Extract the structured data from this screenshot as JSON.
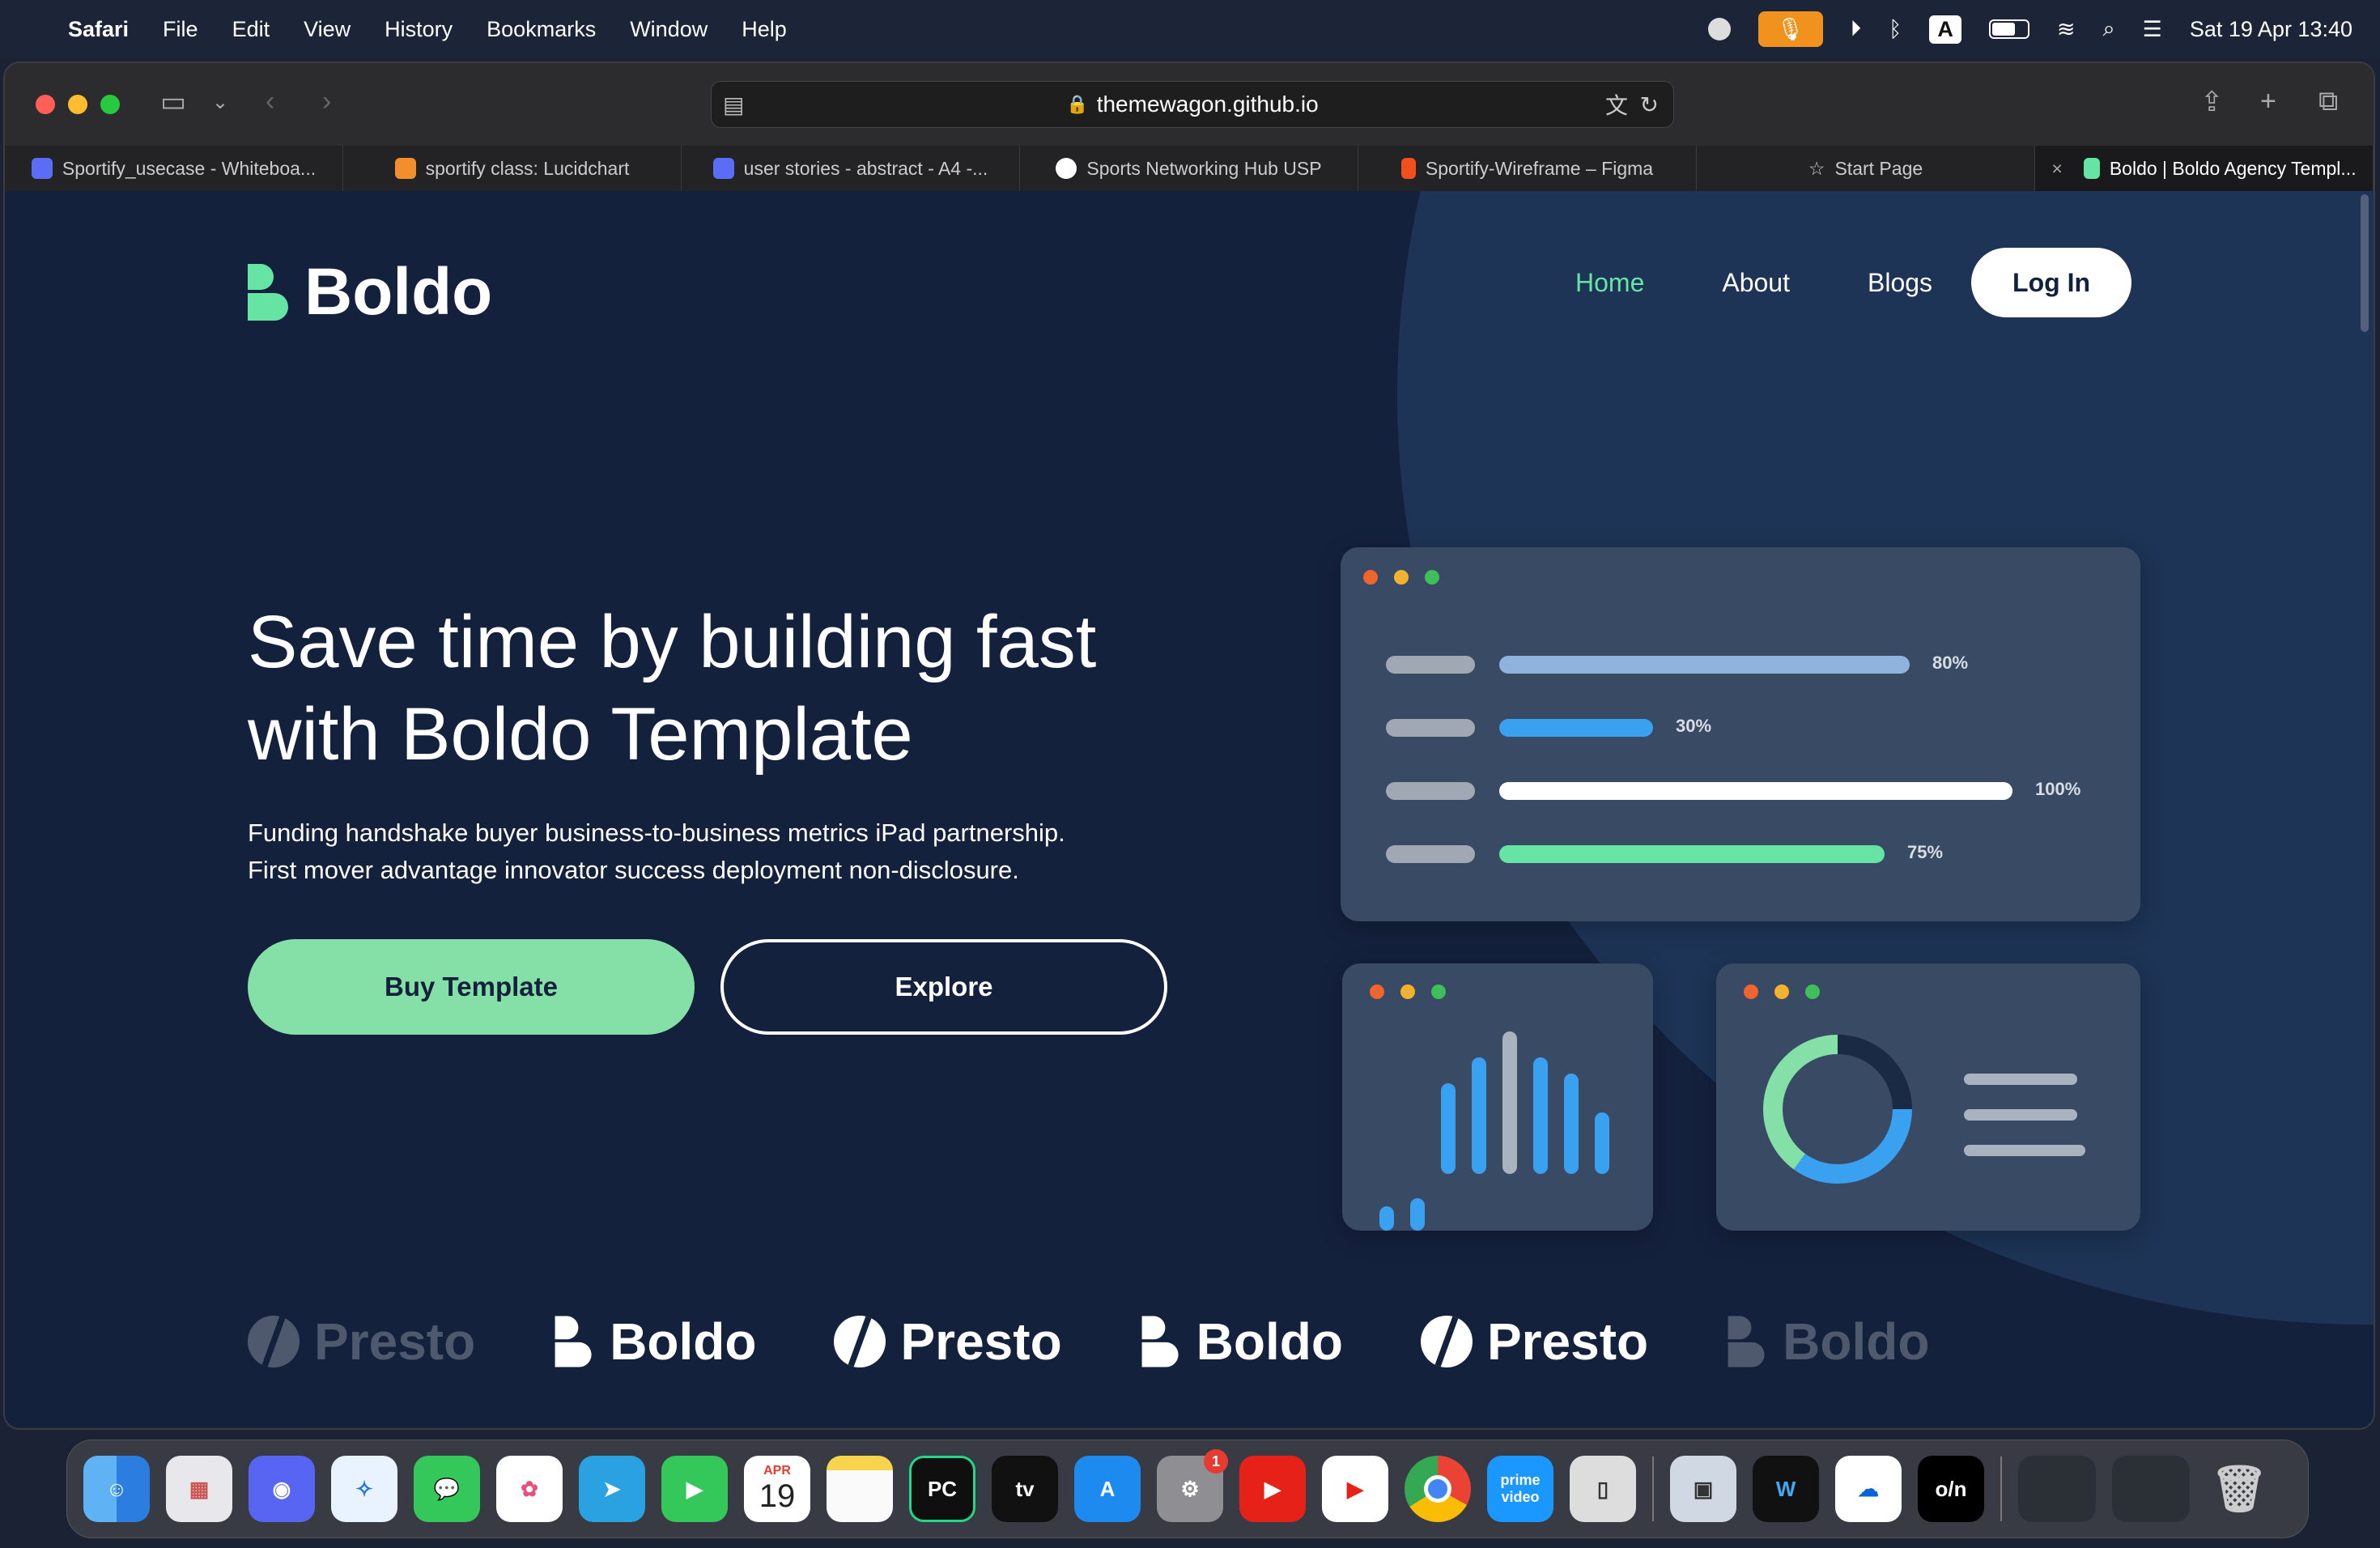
{
  "menubar": {
    "app": "Safari",
    "items": [
      "File",
      "Edit",
      "View",
      "History",
      "Bookmarks",
      "Window",
      "Help"
    ],
    "datetime": "Sat 19 Apr  13:40",
    "keyboard": "A"
  },
  "browser": {
    "url": "themewagon.github.io",
    "tabs": [
      {
        "label": "Sportify_usecase - Whiteboa...",
        "icon": "whiteboard-icon"
      },
      {
        "label": "sportify class: Lucidchart",
        "icon": "lucidchart-icon"
      },
      {
        "label": "user stories - abstract - A4 -...",
        "icon": "whiteboard-icon"
      },
      {
        "label": "Sports Networking Hub USP",
        "icon": "chatgpt-icon"
      },
      {
        "label": "Sportify-Wireframe – Figma",
        "icon": "figma-icon"
      },
      {
        "label": "Start Page",
        "icon": "star-icon"
      },
      {
        "label": "Boldo | Boldo Agency Templ...",
        "icon": "boldo-icon"
      }
    ]
  },
  "site": {
    "logo": "Boldo",
    "nav": {
      "home": "Home",
      "about": "About",
      "blogs": "Blogs",
      "login": "Log In"
    },
    "hero": {
      "line1": "Save time by building fast",
      "line2": "with Boldo Template",
      "sub1": "Funding handshake buyer business-to-business metrics iPad partnership.",
      "sub2": "First mover advantage innovator success deployment non-disclosure.",
      "buy": "Buy Template",
      "explore": "Explore"
    },
    "progress": [
      {
        "label": "80%",
        "value": 0.8,
        "color": "#8fb3dd"
      },
      {
        "label": "30%",
        "value": 0.3,
        "color": "#3aa0f0"
      },
      {
        "label": "100%",
        "value": 1.0,
        "color": "#ffffff"
      },
      {
        "label": "75%",
        "value": 0.75,
        "color": "#65e4a3"
      }
    ],
    "bars": [
      0.15,
      0.2,
      0.56,
      0.72,
      0.88,
      0.72,
      0.62,
      0.38
    ],
    "donut": {
      "green": 0.4,
      "blue": 0.35,
      "dark": 0.25
    },
    "brands": [
      "Presto",
      "Boldo",
      "Presto",
      "Boldo",
      "Presto",
      "Boldo"
    ]
  },
  "dock": {
    "apps": [
      "finder-icon",
      "launchpad-icon",
      "discord-icon",
      "safari-icon",
      "messages-icon",
      "photos-icon",
      "telegram-icon",
      "facetime-icon",
      "calendar-icon",
      "notes-icon",
      "pycharm-icon",
      "appletv-icon",
      "appstore-icon",
      "settings-icon",
      "youtube-icon",
      "youtube-icon",
      "chrome-icon",
      "primevideo-icon",
      "iphone-mirroring-icon"
    ],
    "calendar_month": "APR",
    "calendar_day": "19",
    "settings_badge": "1",
    "appletv_label": "tv",
    "prime_label": "prime video",
    "pycharm_label": "PC"
  }
}
